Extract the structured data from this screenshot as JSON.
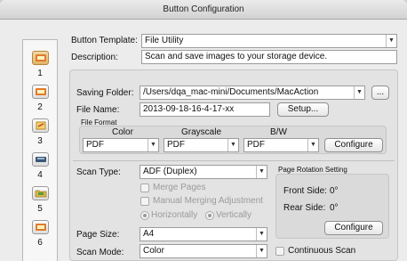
{
  "window": {
    "title": "Button Configuration"
  },
  "sidebar": {
    "items": [
      {
        "num": "1",
        "icon": "scan-to-file-icon"
      },
      {
        "num": "2",
        "icon": "scan-to-file-icon"
      },
      {
        "num": "3",
        "icon": "scan-to-app-icon"
      },
      {
        "num": "4",
        "icon": "scanner-icon"
      },
      {
        "num": "5",
        "icon": "scan-to-folder-icon"
      },
      {
        "num": "6",
        "icon": "scan-to-file-icon"
      }
    ]
  },
  "template": {
    "label": "Button Template:",
    "value": "File Utility"
  },
  "description": {
    "label": "Description:",
    "value": "Scan and save images to your storage device."
  },
  "saving_folder": {
    "label": "Saving Folder:",
    "value": "/Users/dqa_mac-mini/Documents/MacAction",
    "browse_label": "..."
  },
  "file_name": {
    "label": "File Name:",
    "value": "2013-09-18-16-4-17-xx",
    "setup_label": "Setup..."
  },
  "file_format": {
    "label": "File Format",
    "color_label": "Color",
    "grayscale_label": "Grayscale",
    "bw_label": "B/W",
    "color_value": "PDF",
    "grayscale_value": "PDF",
    "bw_value": "PDF",
    "configure_label": "Configure"
  },
  "scan_type": {
    "label": "Scan Type:",
    "value": "ADF (Duplex)",
    "merge_pages": "Merge Pages",
    "manual_merge": "Manual Merging Adjustment",
    "horizontally": "Horizontally",
    "vertically": "Vertically"
  },
  "rotation": {
    "label": "Page Rotation Setting",
    "front_label": "Front Side:",
    "front_value": "0°",
    "rear_label": "Rear Side:",
    "rear_value": "0°",
    "configure_label": "Configure"
  },
  "page_size": {
    "label": "Page Size:",
    "value": "A4"
  },
  "scan_mode": {
    "label": "Scan Mode:",
    "value": "Color",
    "continuous_label": "Continuous Scan"
  }
}
